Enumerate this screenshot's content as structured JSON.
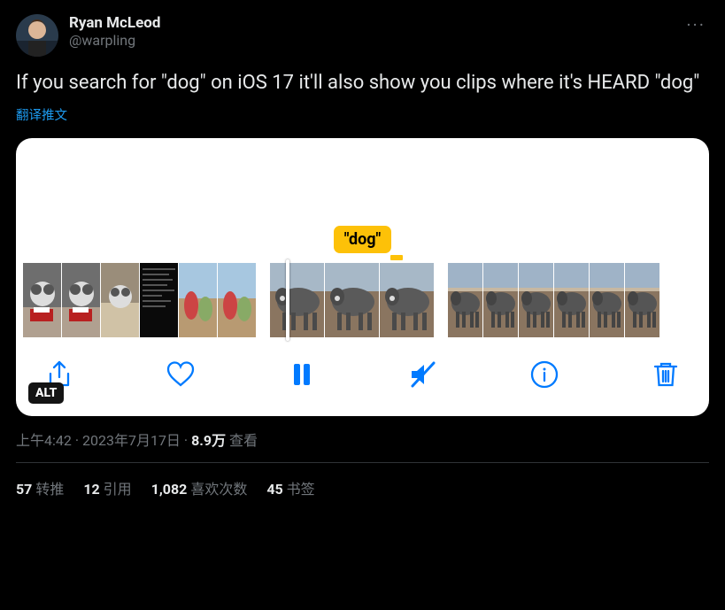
{
  "author": {
    "name": "Ryan McLeod",
    "handle": "@warpling"
  },
  "tweet_text": "If you search for \"dog\" on iOS 17 it'll also show you clips where it's HEARD \"dog\"",
  "translate_label": "翻译推文",
  "media": {
    "caption_pill": "\"dog\"",
    "alt_badge": "ALT"
  },
  "meta": {
    "time": "上午4:42",
    "date": "2023年7月17日",
    "views_value": "8.9万",
    "views_label": "查看"
  },
  "stats": {
    "retweets": {
      "count": "57",
      "label": "转推"
    },
    "quotes": {
      "count": "12",
      "label": "引用"
    },
    "likes": {
      "count": "1,082",
      "label": "喜欢次数"
    },
    "bookmarks": {
      "count": "45",
      "label": "书签"
    }
  },
  "more_glyph": "···"
}
